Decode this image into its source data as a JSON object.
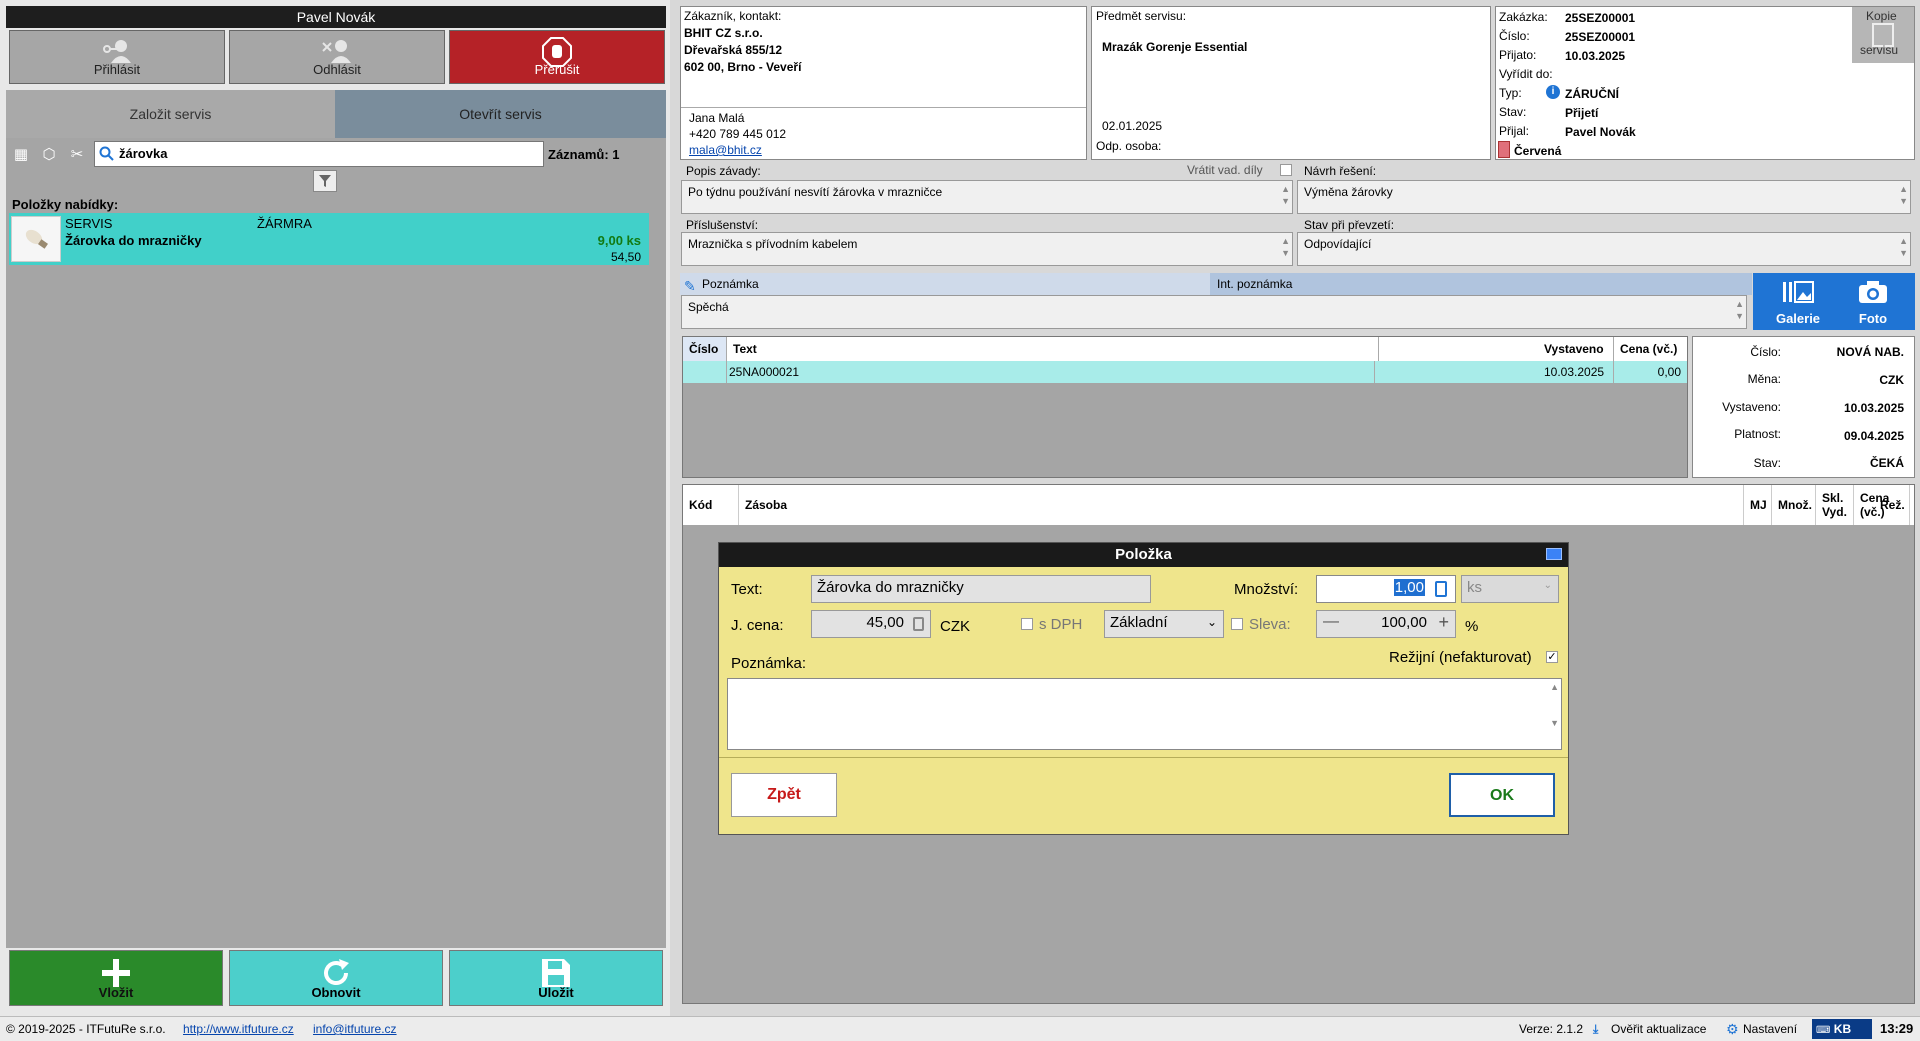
{
  "user": {
    "name": "Pavel Novák"
  },
  "top_buttons": {
    "login": "Přihlásit",
    "logout": "Odhlásit",
    "abort": "Přerušit"
  },
  "tabs": {
    "new_service": "Založit servis",
    "open_service": "Otevřít servis"
  },
  "search": {
    "value": "žárovka",
    "records_label": "Záznamů: 1"
  },
  "offer_list": {
    "label": "Položky nabídky:",
    "items": [
      {
        "category": "SERVIS",
        "code": "ŽÁRMRA",
        "name": "Žárovka do mrazničky",
        "qty": "9,00 ks",
        "price": "54,50"
      }
    ]
  },
  "bottom_buttons": {
    "insert": "Vložit",
    "refresh": "Obnovit",
    "save": "Uložit"
  },
  "customer": {
    "label": "Zákazník, kontakt:",
    "company": "BHIT CZ s.r.o.",
    "street": "Dřevařská 855/12",
    "city": "602 00, Brno - Veveří",
    "contact_name": "Jana Malá",
    "phone": "+420 789 445 012",
    "email": "mala@bhit.cz"
  },
  "subject": {
    "label": "Předmět servisu:",
    "value": "Mrazák Gorenje Essential",
    "date": "02.01.2025",
    "resp_label": "Odp. osoba:"
  },
  "order": {
    "rows": [
      {
        "label": "Zakázka:",
        "value": "25SEZ00001"
      },
      {
        "label": "Číslo:",
        "value": "25SEZ00001"
      },
      {
        "label": "Přijato:",
        "value": "10.03.2025"
      },
      {
        "label": "Vyřídit do:",
        "value": ""
      },
      {
        "label": "Typ:",
        "value": "ZÁRUČNÍ"
      },
      {
        "label": "Stav:",
        "value": "Přijetí"
      },
      {
        "label": "Přijal:",
        "value": "Pavel Novák"
      }
    ],
    "color_label": "Červená",
    "copy_label_1": "Kopie",
    "copy_label_2": "servisu"
  },
  "fault": {
    "label": "Popis závady:",
    "return_parts_label": "Vrátit vad. díly",
    "value": "Po týdnu používání nesvítí žárovka v mrazničce"
  },
  "solution": {
    "label": "Návrh řešení:",
    "value": "Výměna žárovky"
  },
  "accessories": {
    "label": "Příslušenství:",
    "value": "Mraznička s přívodním kabelem"
  },
  "condition": {
    "label": "Stav při převzetí:",
    "value": "Odpovídající"
  },
  "note": {
    "tab_label": "Poznámka",
    "int_tab_label": "Int. poznámka",
    "value": "Spěchá"
  },
  "media_buttons": {
    "gallery": "Galerie",
    "photo": "Foto"
  },
  "offers_table": {
    "headers": [
      "Číslo",
      "Text",
      "Vystaveno",
      "Cena (vč.)"
    ],
    "rows": [
      {
        "number": "",
        "text": "25NA000021",
        "issued": "10.03.2025",
        "price": "0,00"
      }
    ]
  },
  "offer_detail": {
    "rows": [
      {
        "label": "Číslo:",
        "value": "NOVÁ NAB."
      },
      {
        "label": "Měna:",
        "value": "CZK"
      },
      {
        "label": "Vystaveno:",
        "value": "10.03.2025"
      },
      {
        "label": "Platnost:",
        "value": "09.04.2025"
      },
      {
        "label": "Stav:",
        "value": "ČEKÁ"
      }
    ]
  },
  "items_table": {
    "headers": [
      "Kód",
      "Zásoba",
      "MJ",
      "Množ.",
      "Skl. Vyd.",
      "Cena (vč.)",
      "Rež."
    ]
  },
  "dialog": {
    "title": "Položka",
    "text_label": "Text:",
    "text_value": "Žárovka do mrazničky",
    "qty_label": "Množství:",
    "qty_value": "1,00",
    "unit_value": "ks",
    "price_label": "J. cena:",
    "price_value": "45,00",
    "currency": "CZK",
    "vat_label": "s DPH",
    "vat_rate": "Základní",
    "discount_label": "Sleva:",
    "discount_value": "100,00",
    "percent": "%",
    "note_label": "Poznámka:",
    "overhead_label": "Režijní (nefakturovat)",
    "back_button": "Zpět",
    "ok_button": "OK"
  },
  "status_bar": {
    "copyright": "© 2019-2025 - ITFutuRe s.r.o.",
    "website": "http://www.itfuture.cz",
    "email": "info@itfuture.cz",
    "version": "Verze: 2.1.2",
    "check_updates": "Ověřit aktualizace",
    "settings": "Nastavení",
    "keyboard": "KB",
    "time": "13:29"
  },
  "colors": {
    "abort": "#b52227",
    "insert": "#2a8a2a",
    "teal": "#4ccfcb",
    "blue": "#1f74d4",
    "dialog": "#efe58c",
    "red_tag": "#e0707a"
  }
}
